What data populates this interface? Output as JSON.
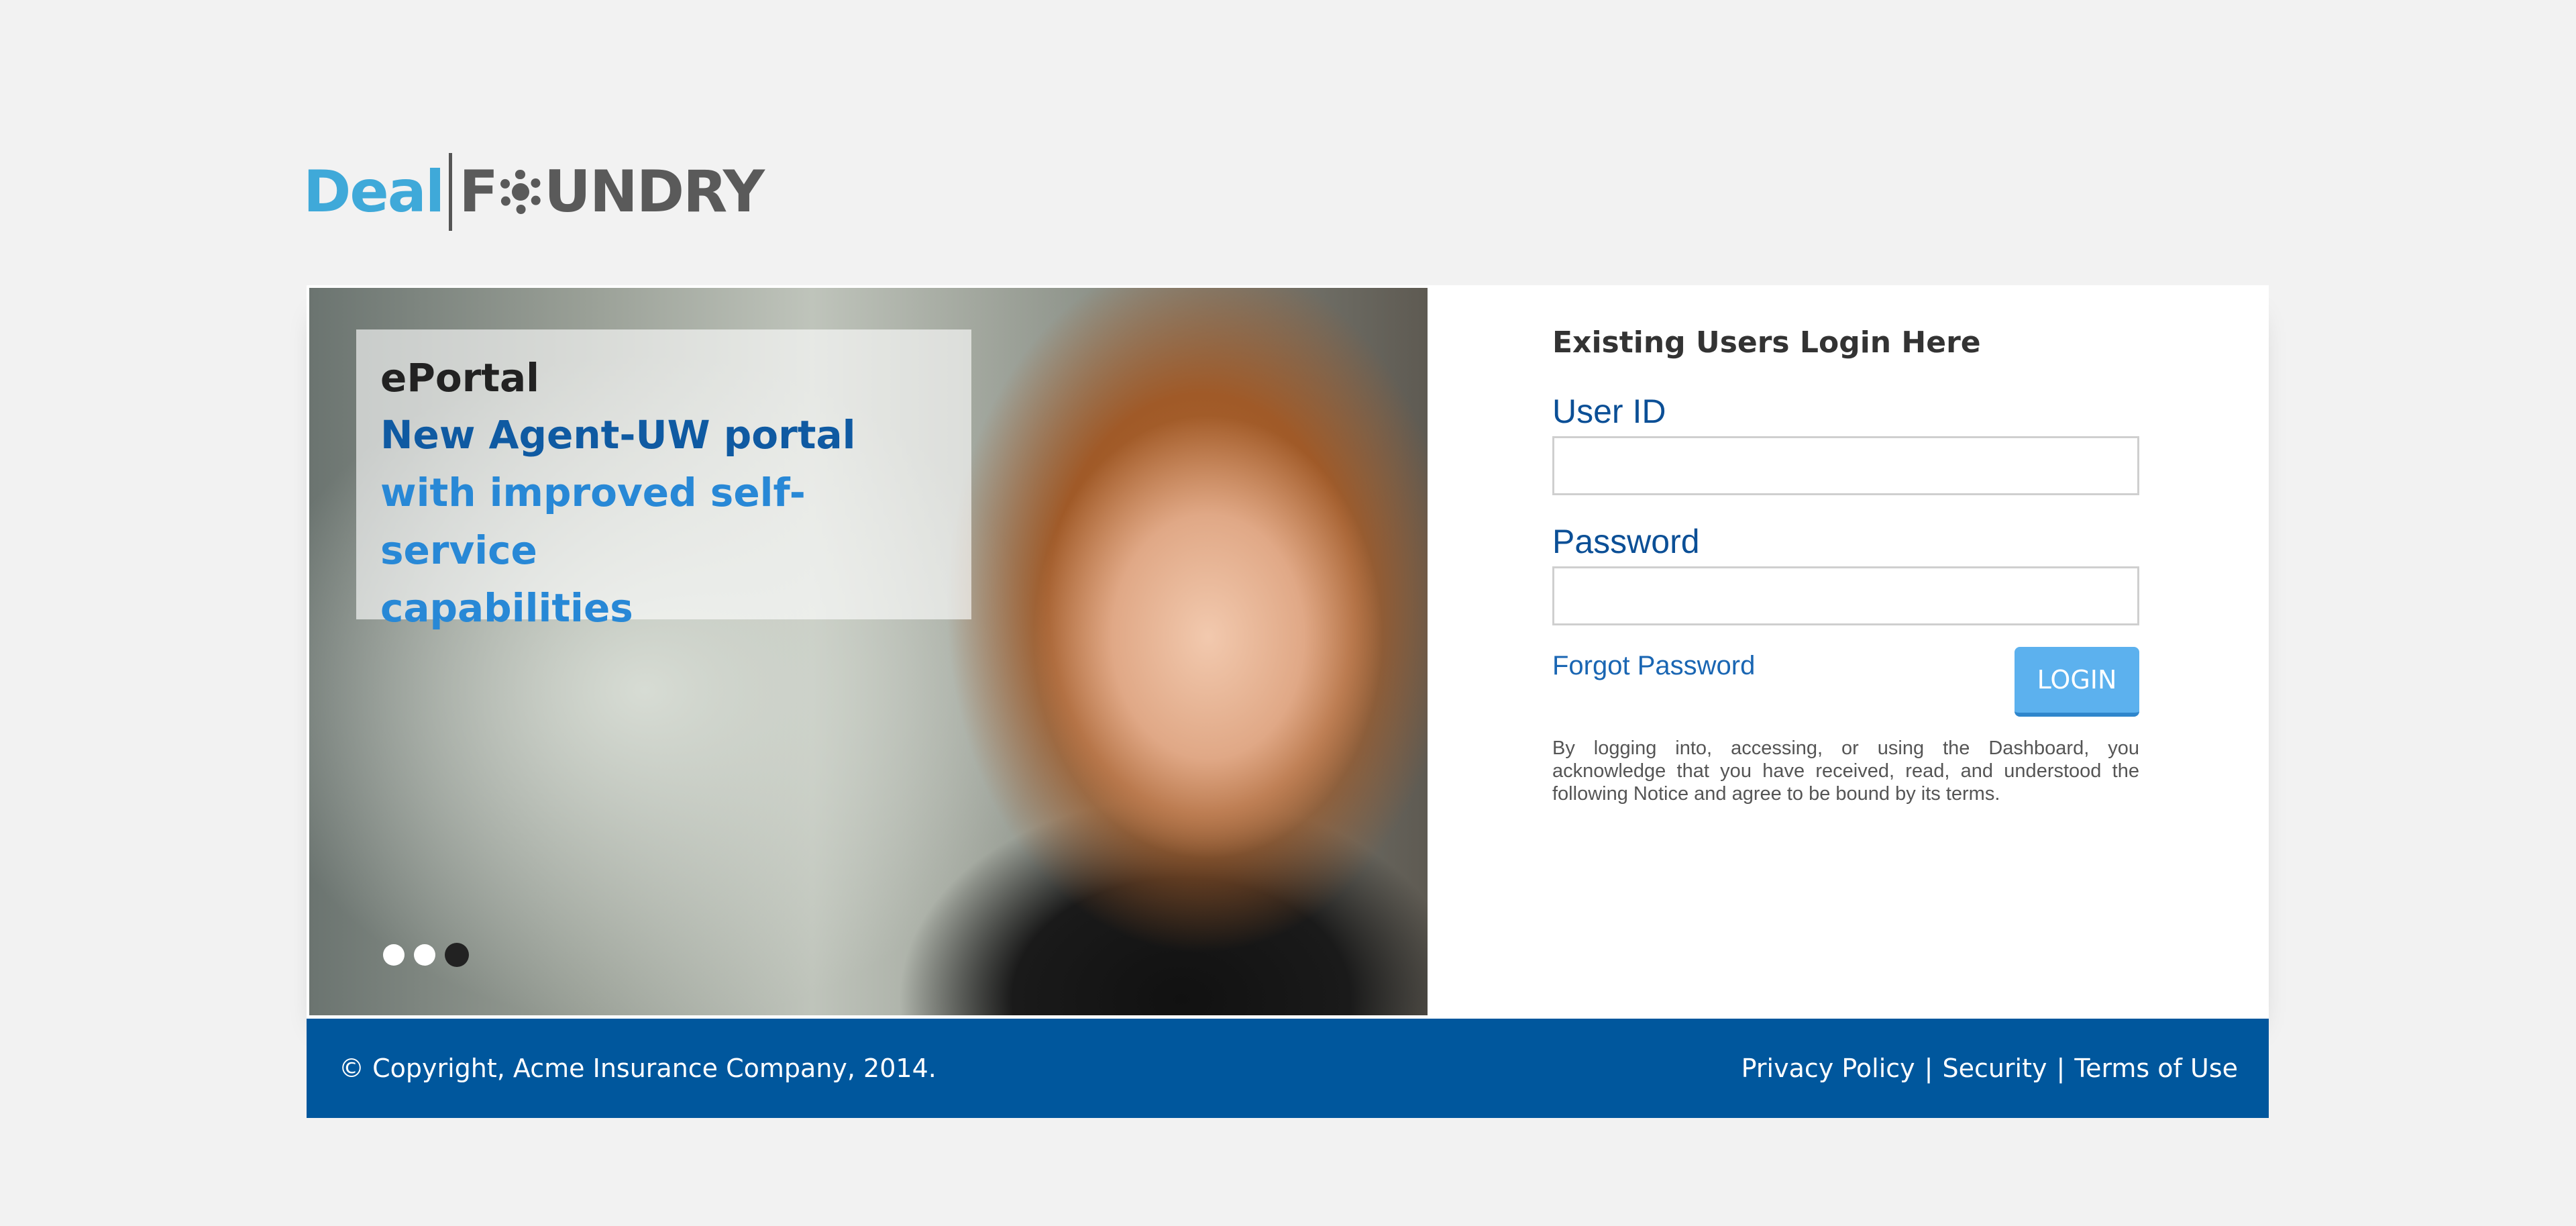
{
  "logo": {
    "part1": "Deal",
    "part2_prefix": "F",
    "part2_suffix": "UNDRY"
  },
  "hero": {
    "title": "ePortal",
    "subtitle_line1": "New Agent-UW portal",
    "subtitle_line2": "with improved self-service",
    "subtitle_line3": "capabilities",
    "slides": 3,
    "active_slide": 3
  },
  "login": {
    "heading": "Existing Users Login Here",
    "user_id_label": "User ID",
    "user_id_value": "",
    "password_label": "Password",
    "password_value": "",
    "forgot_label": "Forgot Password",
    "button_label": "LOGIN",
    "notice": "By logging into, accessing, or using the Dashboard, you acknowledge that you have received, read, and understood the following Notice and agree to be bound by its terms."
  },
  "footer": {
    "copyright": "© Copyright, Acme Insurance Company, 2014.",
    "links": [
      "Privacy Policy",
      "Security",
      "Terms of Use"
    ],
    "separator": "|"
  },
  "colors": {
    "brand_blue": "#00579d",
    "button": "#5cb1ee",
    "label_blue": "#0b4f96"
  }
}
